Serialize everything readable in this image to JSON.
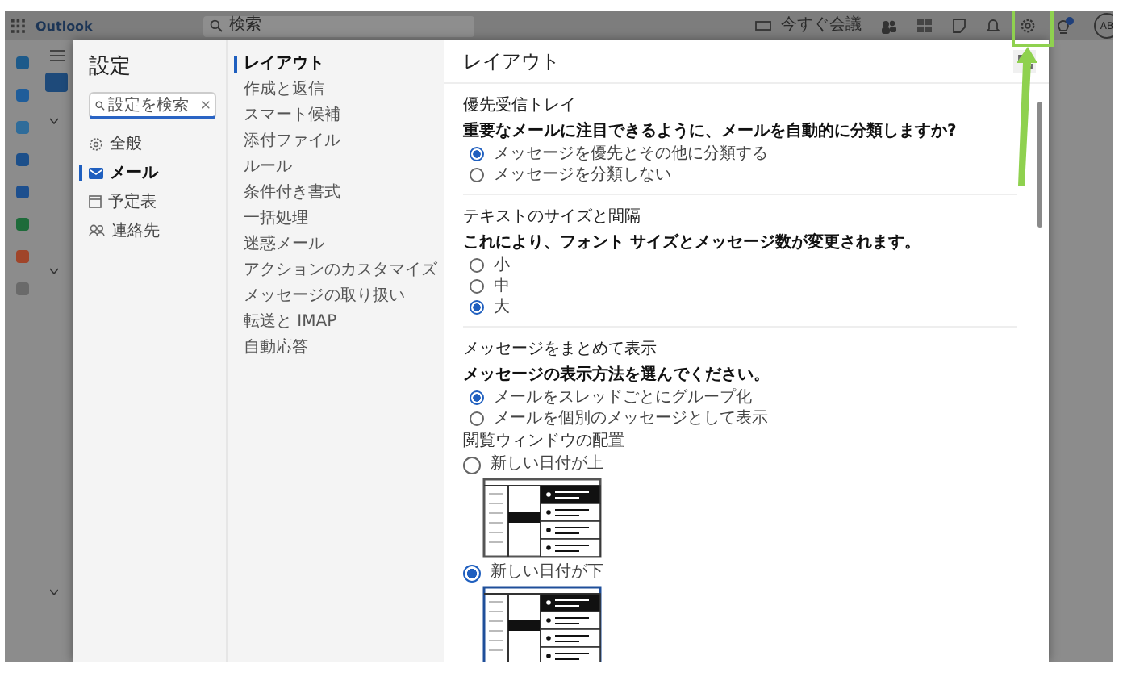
{
  "app_bar": {
    "app_name": "Outlook",
    "search_placeholder": "検索",
    "meet_now": "今すぐ会議",
    "avatar": "AB"
  },
  "settings": {
    "title": "設定",
    "search": {
      "placeholder": "設定を検索"
    },
    "categories": [
      {
        "label": "全般",
        "selected": false
      },
      {
        "label": "メール",
        "selected": true
      },
      {
        "label": "予定表",
        "selected": false
      },
      {
        "label": "連絡先",
        "selected": false
      }
    ],
    "subcategories": [
      {
        "label": "レイアウト",
        "selected": true
      },
      {
        "label": "作成と返信",
        "selected": false
      },
      {
        "label": "スマート候補",
        "selected": false
      },
      {
        "label": "添付ファイル",
        "selected": false
      },
      {
        "label": "ルール",
        "selected": false
      },
      {
        "label": "条件付き書式",
        "selected": false
      },
      {
        "label": "一括処理",
        "selected": false
      },
      {
        "label": "迷惑メール",
        "selected": false
      },
      {
        "label": "アクションのカスタマイズ",
        "selected": false
      },
      {
        "label": "メッセージの取り扱い",
        "selected": false
      },
      {
        "label": "転送と IMAP",
        "selected": false
      },
      {
        "label": "自動応答",
        "selected": false
      }
    ],
    "page_title": "レイアウト",
    "sections": [
      {
        "title": "優先受信トレイ",
        "question": "重要なメールに注目できるように、メールを自動的に分類しますか?",
        "options": [
          {
            "label": "メッセージを優先とその他に分類する",
            "selected": true
          },
          {
            "label": "メッセージを分類しない",
            "selected": false
          }
        ]
      },
      {
        "title": "テキストのサイズと間隔",
        "question": "これにより、フォント サイズとメッセージ数が変更されます。",
        "options": [
          {
            "label": "小",
            "selected": false
          },
          {
            "label": "中",
            "selected": false
          },
          {
            "label": "大",
            "selected": true
          }
        ]
      },
      {
        "title": "メッセージをまとめて表示",
        "question": "メッセージの表示方法を選んでください。",
        "options": [
          {
            "label": "メールをスレッドごとにグループ化",
            "selected": true
          },
          {
            "label": "メールを個別のメッセージとして表示",
            "selected": false
          }
        ],
        "subsection": {
          "title": "閲覧ウィンドウの配置",
          "options": [
            {
              "label": "新しい日付が上",
              "selected": false
            },
            {
              "label": "新しい日付が下",
              "selected": true
            }
          ]
        }
      }
    ]
  }
}
